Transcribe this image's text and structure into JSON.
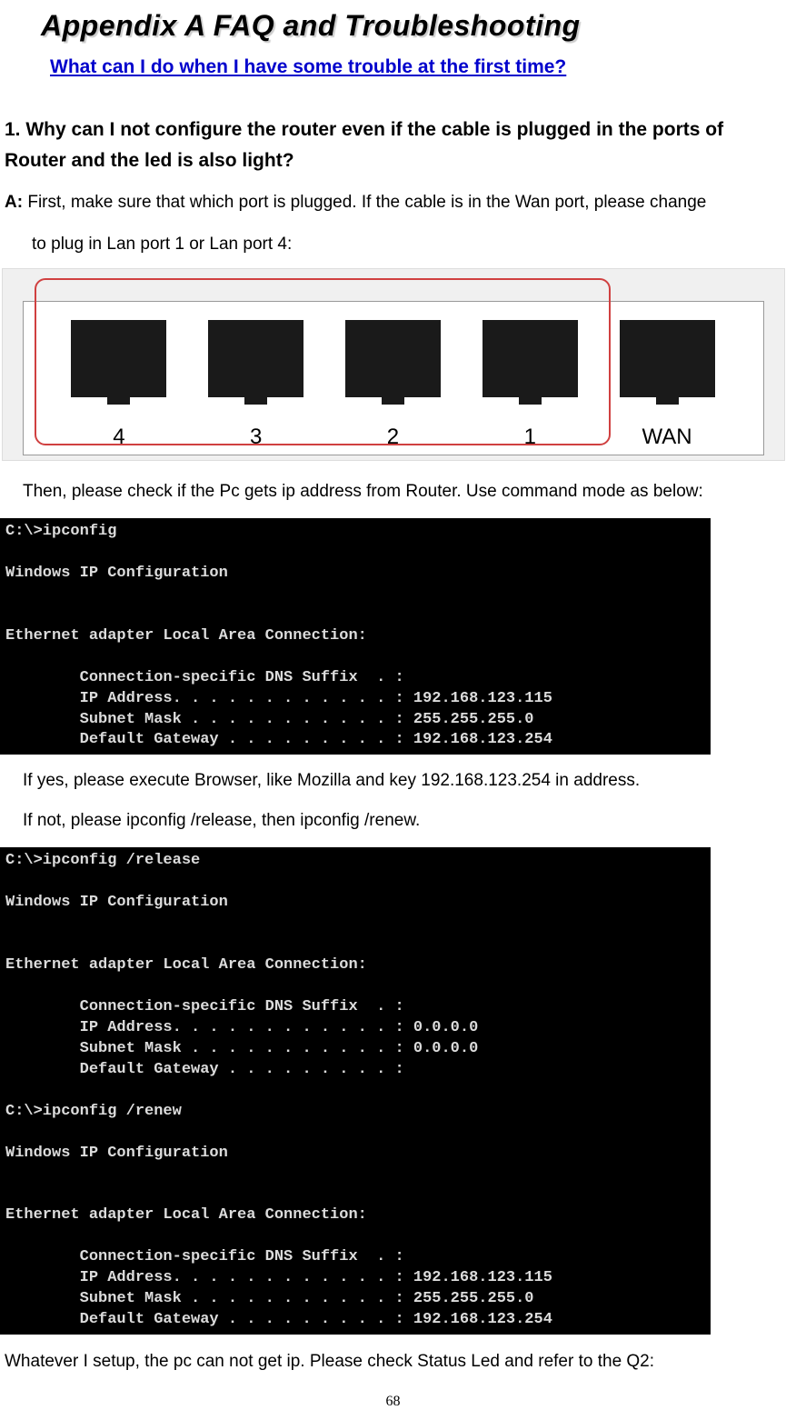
{
  "appendix_title": "Appendix A   FAQ and Troubleshooting",
  "subtitle": "What can I do when I have some trouble at the first time?",
  "q1": "1. Why can I not configure the router  even if the cable is plugged in the ports of Router and the led is also light?",
  "a1_prefix": "A:",
  "a1_text": " First, make sure that which port is plugged. If the cable is in the Wan port, please change",
  "a1_text2": "to plug in Lan port 1 or Lan port 4:",
  "port_labels": [
    "4",
    "3",
    "2",
    "1",
    "WAN"
  ],
  "body1": "Then, please check if the Pc gets ip address from Router. Use command mode as below:",
  "terminal1": "C:\\>ipconfig\n\nWindows IP Configuration\n\n\nEthernet adapter Local Area Connection:\n\n        Connection-specific DNS Suffix  . :\n        IP Address. . . . . . . . . . . . : 192.168.123.115\n        Subnet Mask . . . . . . . . . . . : 255.255.255.0\n        Default Gateway . . . . . . . . . : 192.168.123.254",
  "body2": "If yes, please execute Browser, like Mozilla and key 192.168.123.254 in address.",
  "body3": "If not, please ipconfig /release, then ipconfig /renew.",
  "terminal2": "C:\\>ipconfig /release\n\nWindows IP Configuration\n\n\nEthernet adapter Local Area Connection:\n\n        Connection-specific DNS Suffix  . :\n        IP Address. . . . . . . . . . . . : 0.0.0.0\n        Subnet Mask . . . . . . . . . . . : 0.0.0.0\n        Default Gateway . . . . . . . . . :\n\nC:\\>ipconfig /renew\n\nWindows IP Configuration\n\n\nEthernet adapter Local Area Connection:\n\n        Connection-specific DNS Suffix  . :\n        IP Address. . . . . . . . . . . . : 192.168.123.115\n        Subnet Mask . . . . . . . . . . . : 255.255.255.0\n        Default Gateway . . . . . . . . . : 192.168.123.254",
  "body4": "Whatever I setup, the pc can not get ip. Please check Status Led and refer to the Q2:",
  "page_number": "68"
}
